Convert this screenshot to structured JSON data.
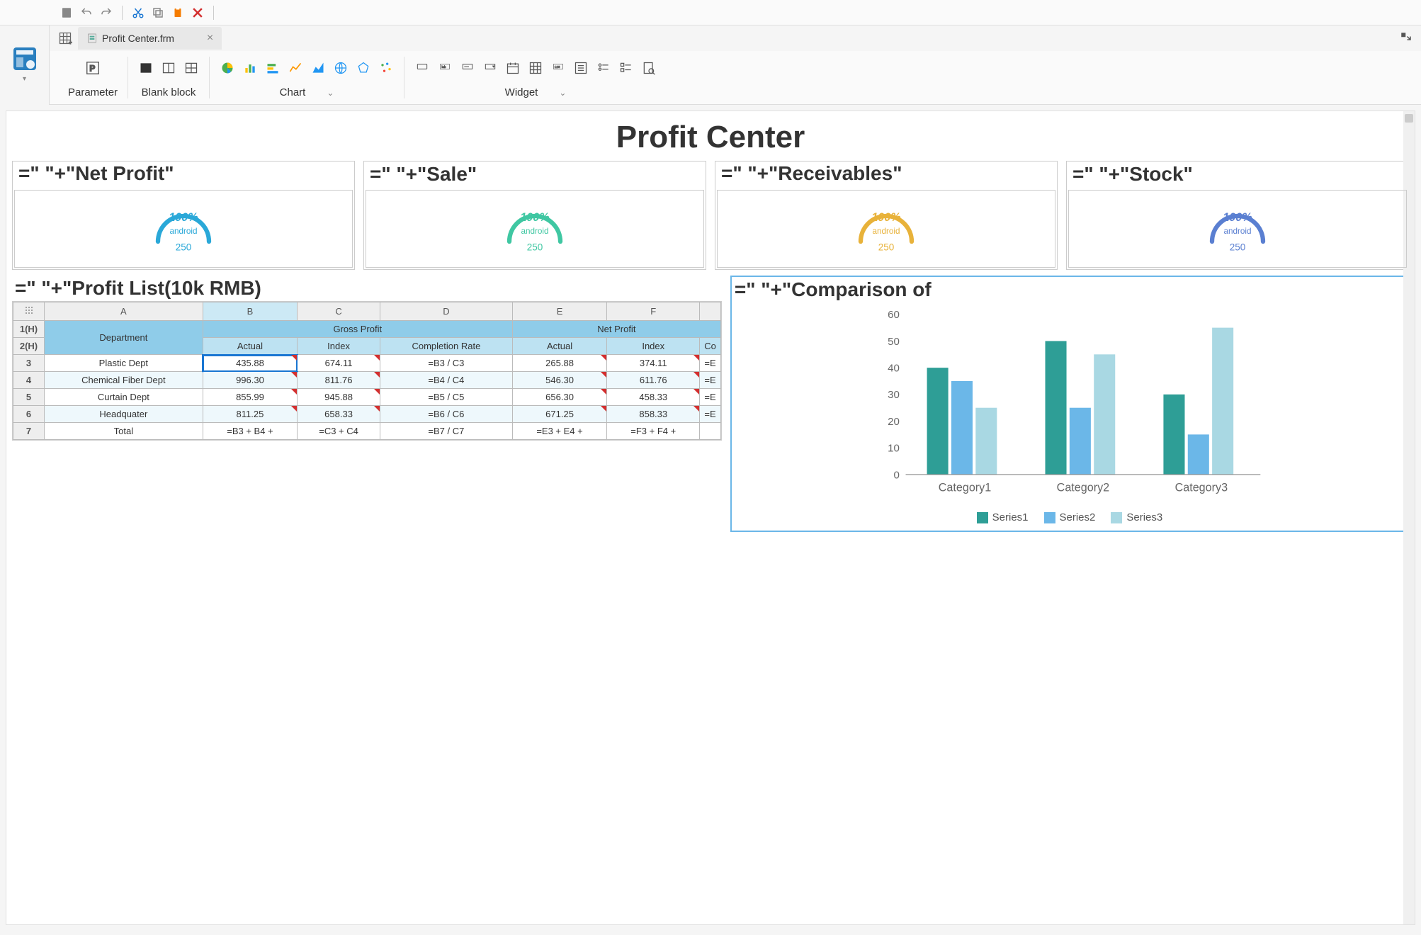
{
  "tab": {
    "filename": "Profit Center.frm"
  },
  "ribbon": {
    "parameter": "Parameter",
    "blank_block": "Blank block",
    "chart": "Chart",
    "widget": "Widget"
  },
  "title": "Profit Center",
  "kpi": [
    {
      "label": "=\"  \"+\"Net Profit\"",
      "pct": "100%",
      "sub": "android",
      "val": "250",
      "color": "#2aa8d8"
    },
    {
      "label": "=\"  \"+\"Sale\"",
      "pct": "100%",
      "sub": "android",
      "val": "250",
      "color": "#3fc7a2"
    },
    {
      "label": "=\"  \"+\"Receivables\"",
      "pct": "100%",
      "sub": "android",
      "val": "250",
      "color": "#e8b23a"
    },
    {
      "label": "=\"  \"+\"Stock\"",
      "pct": "100%",
      "sub": "android",
      "val": "250",
      "color": "#5a7fd1"
    }
  ],
  "left_section_label": "=\"  \"+\"Profit List(10k RMB)",
  "right_section_label": "=\"  \"+\"Comparison of",
  "spreadsheet": {
    "col_letters": [
      "A",
      "B",
      "C",
      "D",
      "E",
      "F"
    ],
    "row_ids": [
      "1(H)",
      "2(H)",
      "3",
      "4",
      "5",
      "6",
      "7"
    ],
    "corner_dept": "Department",
    "group_headers": [
      "Gross Profit",
      "Net Profit"
    ],
    "sub_headers": [
      "Actual",
      "Index",
      "Completion Rate",
      "Actual",
      "Index",
      "Co"
    ],
    "rows": [
      {
        "dept": "Plastic Dept",
        "b": "435.88",
        "c": "674.11",
        "d": "=B3 / C3",
        "e": "265.88",
        "f": "374.11",
        "g": "=E"
      },
      {
        "dept": "Chemical Fiber Dept",
        "b": "996.30",
        "c": "811.76",
        "d": "=B4 / C4",
        "e": "546.30",
        "f": "611.76",
        "g": "=E"
      },
      {
        "dept": "Curtain Dept",
        "b": "855.99",
        "c": "945.88",
        "d": "=B5 / C5",
        "e": "656.30",
        "f": "458.33",
        "g": "=E"
      },
      {
        "dept": "Headquater",
        "b": "811.25",
        "c": "658.33",
        "d": "=B6 / C6",
        "e": "671.25",
        "f": "858.33",
        "g": "=E"
      },
      {
        "dept": "Total",
        "b": "=B3 + B4 +",
        "c": "=C3 + C4",
        "d": "=B7 / C7",
        "e": "=E3 + E4 +",
        "f": "=F3 + F4 +",
        "g": ""
      }
    ]
  },
  "chart_data": {
    "type": "bar",
    "categories": [
      "Category1",
      "Category2",
      "Category3"
    ],
    "series": [
      {
        "name": "Series1",
        "values": [
          40,
          50,
          30
        ],
        "color": "#2e9e96"
      },
      {
        "name": "Series2",
        "values": [
          35,
          25,
          15
        ],
        "color": "#6bb7e8"
      },
      {
        "name": "Series3",
        "values": [
          25,
          45,
          55
        ],
        "color": "#a9d8e3"
      }
    ],
    "ylim": [
      0,
      60
    ],
    "yticks": [
      0,
      10,
      20,
      30,
      40,
      50,
      60
    ]
  }
}
